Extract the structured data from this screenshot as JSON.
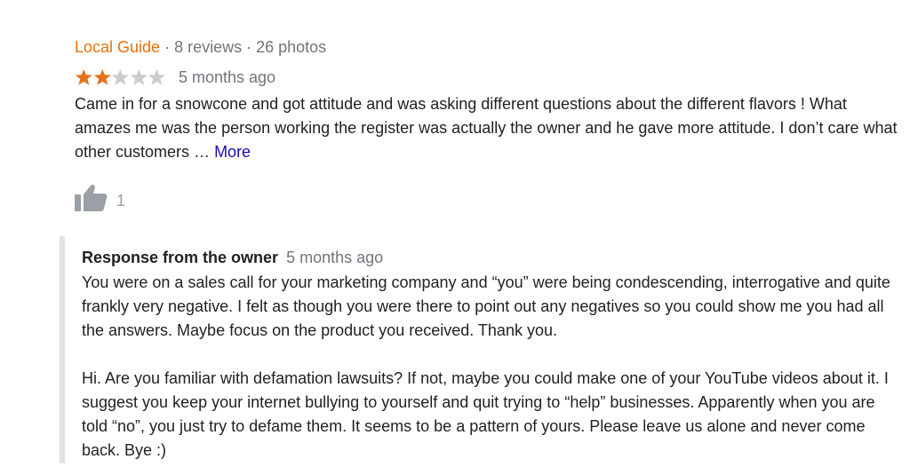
{
  "review": {
    "reviewer_badge": "Local Guide",
    "separator_1": " · ",
    "reviews_count": "8 reviews",
    "separator_2": " · ",
    "photos_count": "26 photos",
    "rating": 2,
    "rating_max": 5,
    "date": "5 months ago",
    "text": "Came in for a snowcone and got attitude and was asking different questions about the different flavors ! What amazes me was the person working the register was actually the owner and he gave more attitude. I don’t care what other customers … ",
    "more_label": "More",
    "likes": "1"
  },
  "response": {
    "title": "Response from the owner",
    "date": "5 months ago",
    "text": "You were on a sales call for your marketing company and “you” were being condescending, interrogative and quite frankly very negative. I felt as though you were there to point out any negatives so you could show me you had all the answers. Maybe focus on the product you received. Thank you.\n\nHi. Are you familiar with defamation lawsuits? If not, maybe you could make one of your YouTube videos about it. I suggest you keep your internet bullying to yourself and quit trying to “help” businesses. Apparently when you are told “no”, you just try to defame them. It seems to be a pattern of yours. Please leave us alone and never come back. Bye :)"
  },
  "colors": {
    "star_filled": "#e7711b",
    "star_empty": "#cccccc",
    "guide": "#e8710a",
    "link": "#1a0dab",
    "thumb": "#9aa0a6"
  },
  "icons": {
    "star": "star-icon",
    "thumb": "thumbs-up-icon"
  }
}
